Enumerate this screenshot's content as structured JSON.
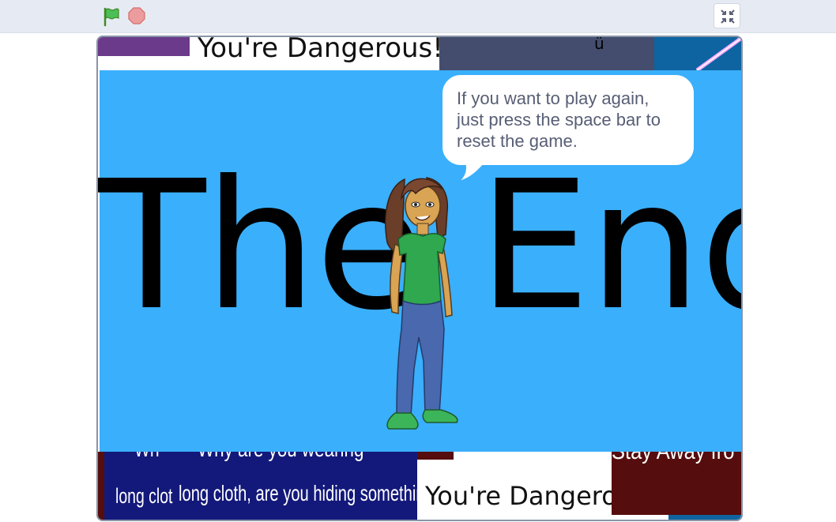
{
  "toolbar": {
    "green_flag": "green-flag-icon",
    "stop": "stop-icon",
    "unfullscreen": "exit-fullscreen-icon"
  },
  "stage": {
    "top_left_text": "You're Dangerous!",
    "top_center_text": "ü",
    "bottom_left_text_1": "long clot",
    "bottom_left_text_2": "long cloth, are you hiding something",
    "bottom_left_partial_top": "Why are you wearing",
    "bottom_left_partial_top_short": "Wh",
    "bottom_center_text": "You're Dangero",
    "bottom_right_text": "Stay Away fro",
    "title": "The End",
    "speech_bubble": "If you want to play again, just press the space bar to reset the game.",
    "colors": {
      "panel": "#3aaffc",
      "navy": "#13197a",
      "maroon": "#560d0d",
      "slate": "#454d6e",
      "purple": "#6b3a8a"
    }
  }
}
